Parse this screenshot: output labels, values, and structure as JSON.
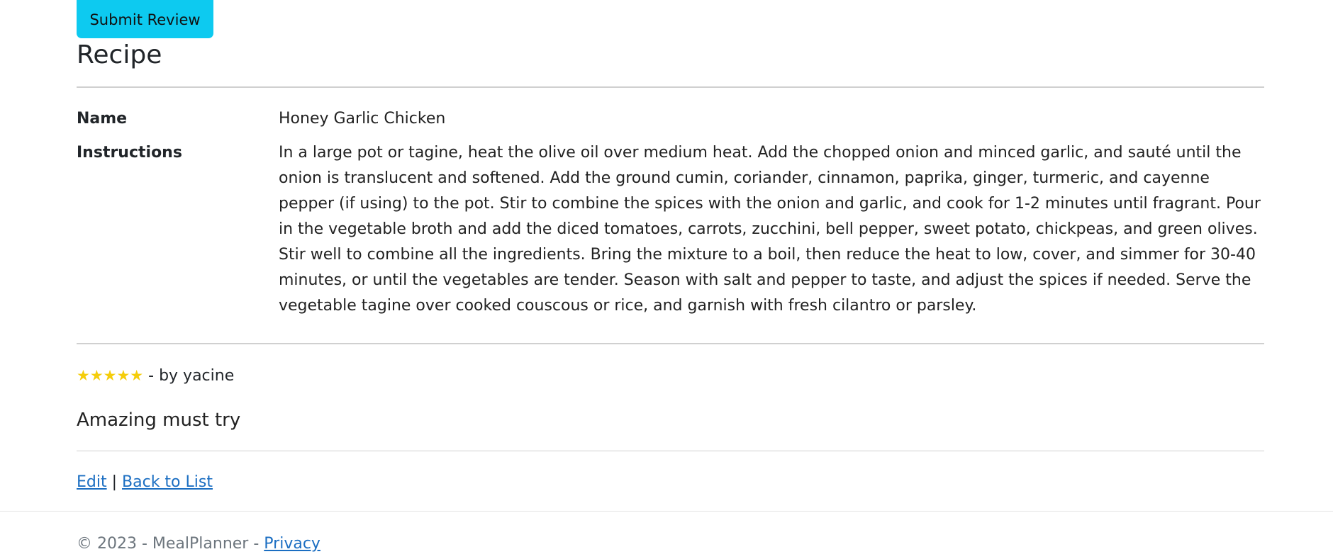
{
  "toolbar": {
    "submit_label": "Submit Review"
  },
  "page": {
    "title": "Recipe"
  },
  "recipe": {
    "name_label": "Name",
    "name_value": "Honey Garlic Chicken",
    "instructions_label": "Instructions",
    "instructions_value": "In a large pot or tagine, heat the olive oil over medium heat. Add the chopped onion and minced garlic, and sauté until the onion is translucent and softened. Add the ground cumin, coriander, cinnamon, paprika, ginger, turmeric, and cayenne pepper (if using) to the pot. Stir to combine the spices with the onion and garlic, and cook for 1-2 minutes until fragrant. Pour in the vegetable broth and add the diced tomatoes, carrots, zucchini, bell pepper, sweet potato, chickpeas, and green olives. Stir well to combine all the ingredients. Bring the mixture to a boil, then reduce the heat to low, cover, and simmer for 30-40 minutes, or until the vegetables are tender. Season with salt and pepper to taste, and adjust the spices if needed. Serve the vegetable tagine over cooked couscous or rice, and garnish with fresh cilantro or parsley."
  },
  "review": {
    "stars": "★★★★★",
    "rating": 5,
    "rating_max": 5,
    "author_text": " - by yacine",
    "text": "Amazing must try"
  },
  "actions": {
    "edit_label": "Edit",
    "separator": "|",
    "back_label": "Back to List"
  },
  "footer": {
    "copyright": "© 2023 - MealPlanner - ",
    "privacy_label": "Privacy"
  },
  "colors": {
    "button_bg": "#0dcaf0",
    "star": "#f5cd0a",
    "link": "#1b6ec2",
    "footer_text": "#6c757d"
  }
}
